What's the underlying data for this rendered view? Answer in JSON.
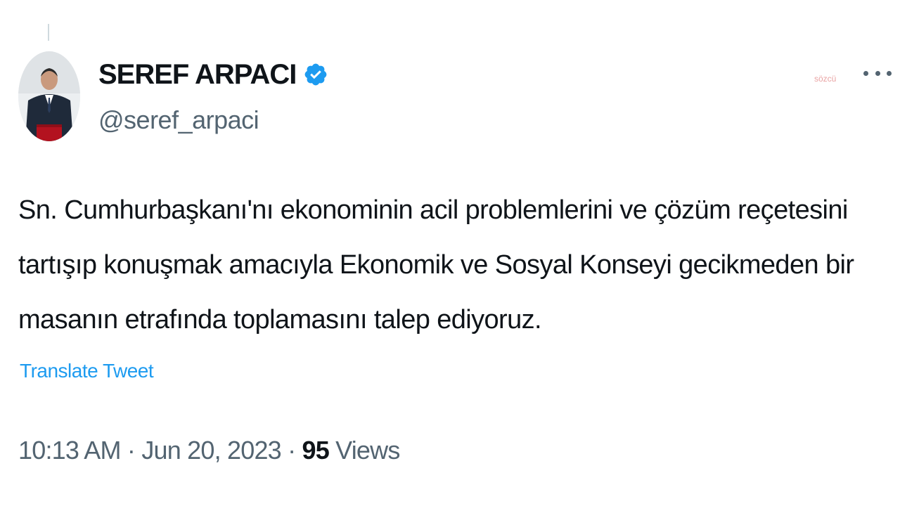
{
  "author": {
    "display_name": "SEREF ARPACI",
    "handle": "@seref_arpaci",
    "verified": true
  },
  "faint_mark": "sözcü",
  "tweet": {
    "lines": [
      "Sn. Cumhurbaşkanı'nı ekonominin acil problemlerini ve çözüm reçetesini",
      "tartışıp konuşmak amacıyla Ekonomik ve Sosyal Konseyi gecikmeden bir",
      "masanın etrafında toplamasını talep ediyoruz."
    ],
    "translate_label": "Translate Tweet"
  },
  "meta": {
    "time": "10:13 AM",
    "separator": "·",
    "date": "Jun 20, 2023",
    "views_count": "95",
    "views_label": "Views"
  },
  "colors": {
    "accent": "#1d9bf0",
    "secondary_text": "#536471",
    "primary_text": "#0f1419"
  },
  "icons": {
    "verified": "verified-badge-icon",
    "more": "more-horizontal-icon"
  }
}
